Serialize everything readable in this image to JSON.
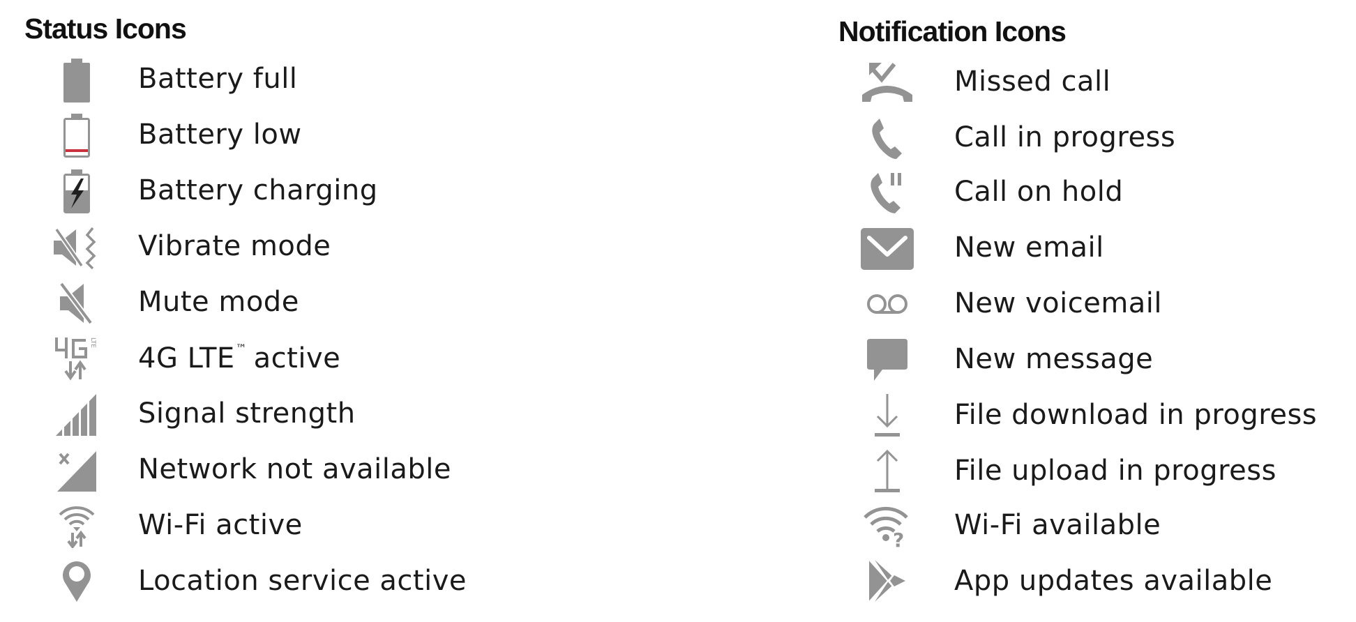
{
  "status": {
    "heading": "Status Icons",
    "items": [
      {
        "icon": "battery-full-icon",
        "label": "Battery full"
      },
      {
        "icon": "battery-low-icon",
        "label": "Battery low"
      },
      {
        "icon": "battery-charging-icon",
        "label": "Battery charging"
      },
      {
        "icon": "vibrate-mode-icon",
        "label": "Vibrate mode"
      },
      {
        "icon": "mute-mode-icon",
        "label": "Mute mode"
      },
      {
        "icon": "4g-lte-icon",
        "label": "4G LTE",
        "label_sup": "™",
        "label_suffix": "active"
      },
      {
        "icon": "signal-strength-icon",
        "label": "Signal strength"
      },
      {
        "icon": "network-not-available-icon",
        "label": "Network not available"
      },
      {
        "icon": "wifi-active-icon",
        "label": "Wi-Fi active"
      },
      {
        "icon": "location-icon",
        "label": "Location service active"
      }
    ]
  },
  "notifications": {
    "heading": "Notification Icons",
    "items": [
      {
        "icon": "missed-call-icon",
        "label": "Missed call"
      },
      {
        "icon": "call-in-progress-icon",
        "label": "Call in progress"
      },
      {
        "icon": "call-on-hold-icon",
        "label": "Call on hold"
      },
      {
        "icon": "email-icon",
        "label": "New email"
      },
      {
        "icon": "voicemail-icon",
        "label": "New voicemail"
      },
      {
        "icon": "message-icon",
        "label": "New message"
      },
      {
        "icon": "download-icon",
        "label": "File download in progress"
      },
      {
        "icon": "upload-icon",
        "label": "File upload in progress"
      },
      {
        "icon": "wifi-available-icon",
        "label": "Wi-Fi available"
      },
      {
        "icon": "app-updates-icon",
        "label": "App updates available"
      }
    ]
  },
  "colors": {
    "icon_gray": "#939393",
    "battery_low_red": "#c8323c",
    "text": "#1a1a1a"
  }
}
